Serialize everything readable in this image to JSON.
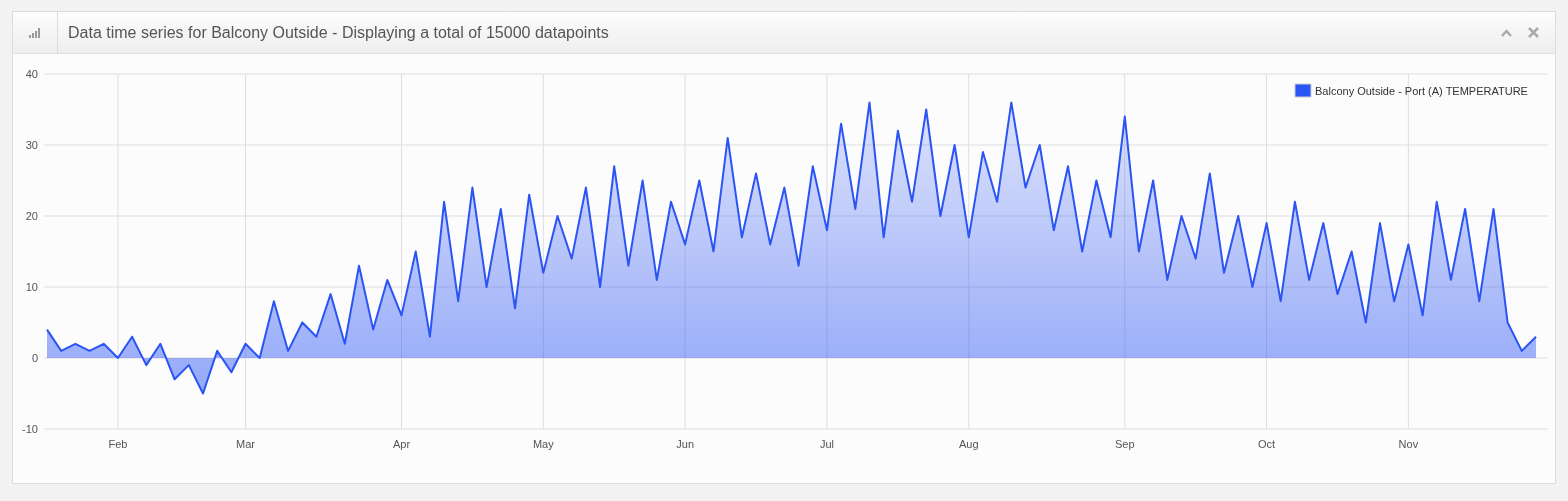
{
  "panel": {
    "title": "Data time series for Balcony Outside - Displaying a total of 15000 datapoints"
  },
  "chart_data": {
    "type": "area",
    "categories": [
      null,
      null,
      null,
      null,
      null,
      "Feb",
      null,
      null,
      null,
      null,
      null,
      null,
      null,
      null,
      "Mar",
      null,
      null,
      null,
      null,
      null,
      null,
      null,
      null,
      null,
      null,
      "Apr",
      null,
      null,
      null,
      null,
      null,
      null,
      null,
      null,
      null,
      "May",
      null,
      null,
      null,
      null,
      null,
      null,
      null,
      null,
      null,
      "Jun",
      null,
      null,
      null,
      null,
      null,
      null,
      null,
      null,
      null,
      "Jul",
      null,
      null,
      null,
      null,
      null,
      null,
      null,
      null,
      null,
      "Aug",
      null,
      null,
      null,
      null,
      null,
      null,
      null,
      null,
      null,
      null,
      "Sep",
      null,
      null,
      null,
      null,
      null,
      null,
      null,
      null,
      null,
      "Oct",
      null,
      null,
      null,
      null,
      null,
      null,
      null,
      null,
      null,
      "Nov",
      null,
      null,
      null,
      null,
      null,
      null,
      null,
      null,
      null
    ],
    "series": [
      {
        "name": "Balcony Outside - Port (A) TEMPERATURE",
        "color": "#2b54f5",
        "values": [
          4,
          1,
          2,
          1,
          2,
          0,
          3,
          -1,
          2,
          -3,
          -1,
          -5,
          1,
          -2,
          2,
          0,
          8,
          1,
          5,
          3,
          9,
          2,
          13,
          4,
          11,
          6,
          15,
          3,
          22,
          8,
          24,
          10,
          21,
          7,
          23,
          12,
          20,
          14,
          24,
          10,
          27,
          13,
          25,
          11,
          22,
          16,
          25,
          15,
          31,
          17,
          26,
          16,
          24,
          13,
          27,
          18,
          33,
          21,
          36,
          17,
          32,
          22,
          35,
          20,
          30,
          17,
          29,
          22,
          36,
          24,
          30,
          18,
          27,
          15,
          25,
          17,
          34,
          15,
          25,
          11,
          20,
          14,
          26,
          12,
          20,
          10,
          19,
          8,
          22,
          11,
          19,
          9,
          15,
          5,
          19,
          8,
          16,
          6,
          22,
          11,
          21,
          8,
          21,
          5,
          1,
          3
        ]
      }
    ],
    "ylim": [
      -10,
      40
    ],
    "yticks": [
      -10,
      0,
      10,
      20,
      30,
      40
    ],
    "grid": true
  }
}
